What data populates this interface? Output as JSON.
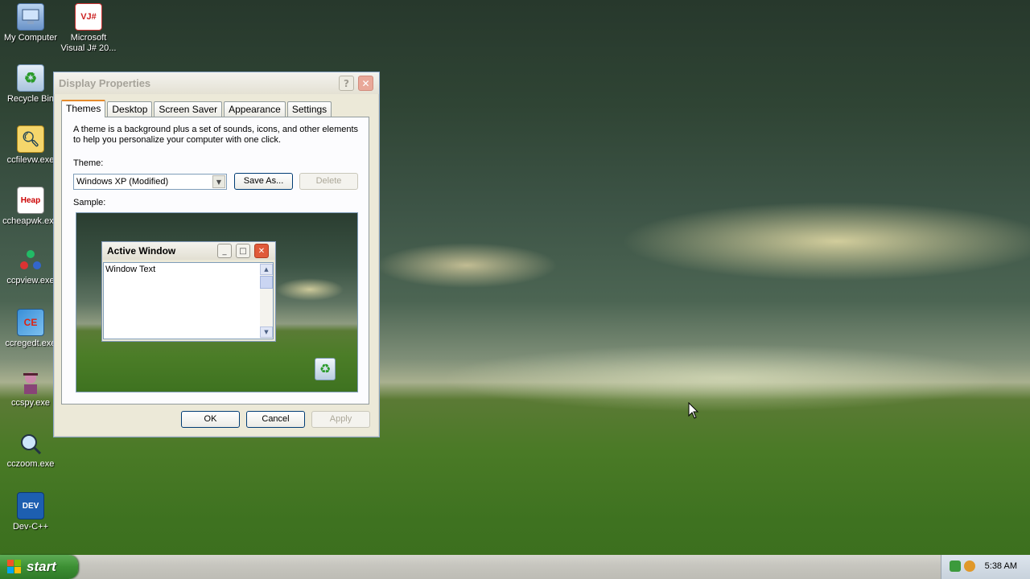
{
  "desktop": {
    "icons": [
      {
        "label": "My Computer",
        "glyph": "computer-icon"
      },
      {
        "label": "Microsoft Visual J# 20...",
        "glyph": "vj-icon"
      },
      {
        "label": "Recycle Bin",
        "glyph": "recycle-bin-icon"
      },
      {
        "label": "ccfilevw.exe",
        "glyph": "magnifier-icon"
      },
      {
        "label": "ccheapwk.exe",
        "glyph": "heap-icon",
        "glyph_text": "Heap"
      },
      {
        "label": "ccpview.exe",
        "glyph": "process-icon"
      },
      {
        "label": "ccregedt.exe",
        "glyph": "regedit-icon",
        "glyph_text": "CE"
      },
      {
        "label": "ccspy.exe",
        "glyph": "spy-icon"
      },
      {
        "label": "cczoom.exe",
        "glyph": "zoom-icon"
      },
      {
        "label": "Dev-C++",
        "glyph": "dev-icon",
        "glyph_text": "DEV"
      }
    ]
  },
  "dialog": {
    "title": "Display Properties",
    "help": "?",
    "close": "✕",
    "tabs": [
      "Themes",
      "Desktop",
      "Screen Saver",
      "Appearance",
      "Settings"
    ],
    "active_tab": "Themes",
    "description": "A theme is a background plus a set of sounds, icons, and other elements to help you personalize your computer with one click.",
    "theme_label": "Theme:",
    "theme_value": "Windows XP (Modified)",
    "save_as": "Save As...",
    "delete": "Delete",
    "sample_label": "Sample:",
    "sample": {
      "active_window_title": "Active Window",
      "window_text": "Window Text"
    },
    "ok": "OK",
    "cancel": "Cancel",
    "apply": "Apply"
  },
  "taskbar": {
    "start_label": "start",
    "clock": "5:38 AM"
  },
  "colors": {
    "tab_highlight": "#e68b2c",
    "start_green": "#3c8f33",
    "close_red": "#e05a3a"
  }
}
